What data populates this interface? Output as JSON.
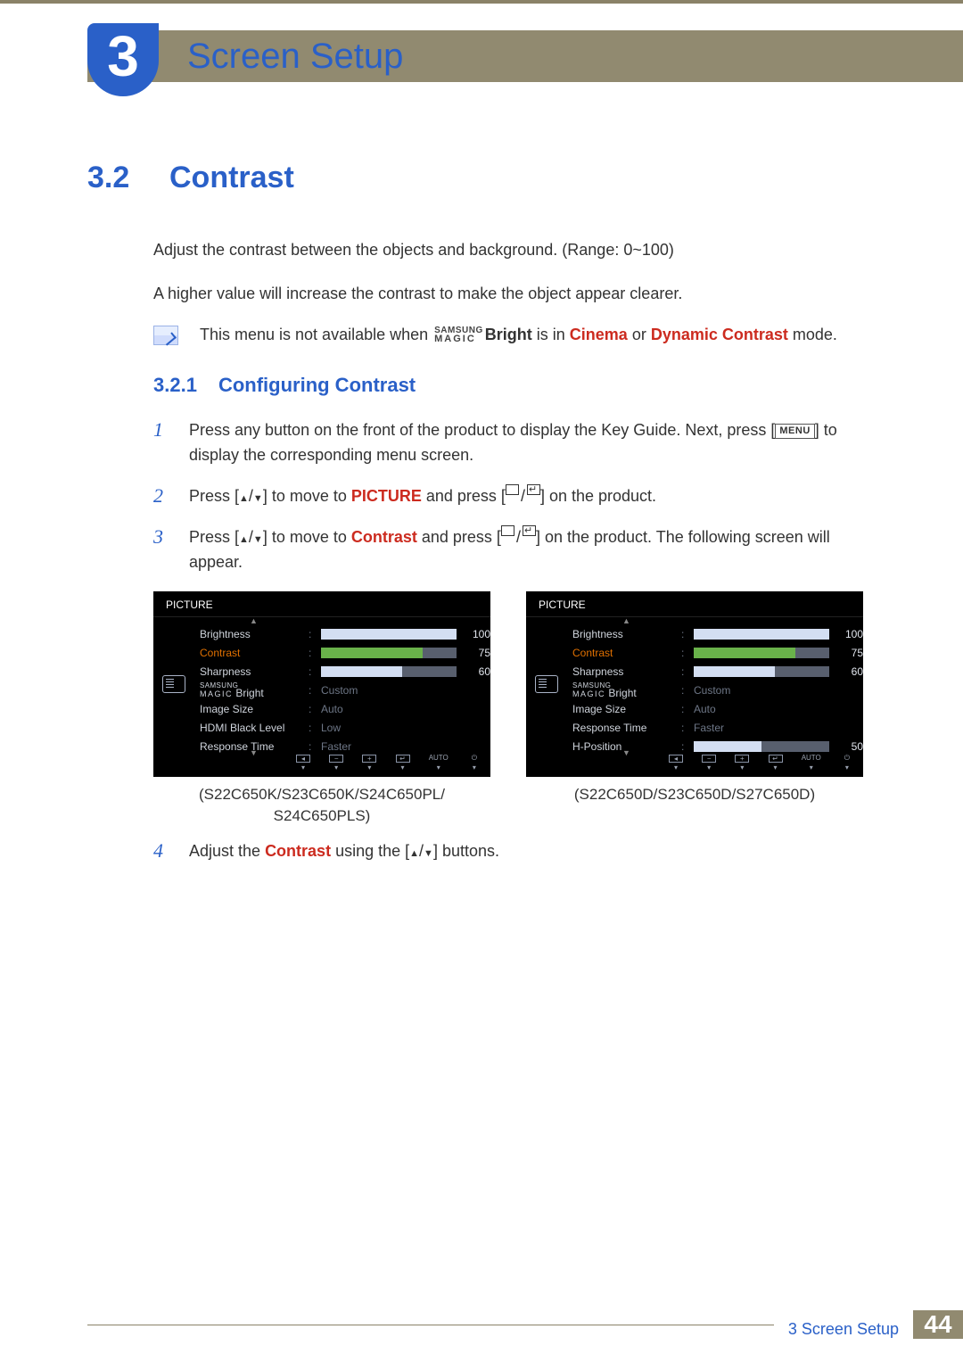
{
  "chapter": {
    "number": "3",
    "title": "Screen Setup"
  },
  "section": {
    "number": "3.2",
    "title": "Contrast"
  },
  "paras": {
    "intro1": "Adjust the contrast between the objects and background. (Range: 0~100)",
    "intro2": "A higher value will increase the contrast to make the object appear clearer."
  },
  "note": {
    "pre": "This menu is not available when ",
    "bright": "Bright",
    "mid": " is in ",
    "cinema": "Cinema",
    "or": " or ",
    "dyn": "Dynamic Contrast",
    "post": " mode."
  },
  "subsection": {
    "number": "3.2.1",
    "title": "Configuring Contrast"
  },
  "steps": {
    "s1a": "Press any button on the front of the product to display the Key Guide. Next, press [",
    "s1menu": "MENU",
    "s1b": "] to display the corresponding menu screen.",
    "s2a": "Press [",
    "s2b": "] to move to ",
    "s2c": "PICTURE",
    "s2d": " and press [",
    "s2e": "] on the product.",
    "s3a": "Press [",
    "s3b": "] to move to ",
    "s3c": "Contrast",
    "s3d": " and press [",
    "s3e": "] on the product. The following screen will appear.",
    "s4a": "Adjust the ",
    "s4b": "Contrast",
    "s4c": " using the [",
    "s4d": "] buttons."
  },
  "osd": {
    "title": "PICTURE",
    "labels": {
      "brightness": "Brightness",
      "contrast": "Contrast",
      "sharpness": "Sharpness",
      "magicBright": "Bright",
      "imageSize": "Image Size",
      "hdmiBlack": "HDMI Black Level",
      "response": "Response Time",
      "hpos": "H-Position"
    },
    "values": {
      "custom": "Custom",
      "auto": "Auto",
      "low": "Low",
      "faster": "Faster"
    },
    "numbers": {
      "brightness": "100",
      "contrast": "75",
      "sharpness": "60",
      "hpos": "50"
    },
    "foot": {
      "auto": "AUTO"
    }
  },
  "captions": {
    "left": "(S22C650K/S23C650K/S24C650PL/\nS24C650PLS)",
    "right": "(S22C650D/S23C650D/S27C650D)"
  },
  "footer": {
    "chapter": "3 Screen Setup",
    "page": "44"
  },
  "chart_data": [
    {
      "type": "table",
      "title": "PICTURE OSD (S22C650K/S23C650K/S24C650PL/S24C650PLS)",
      "rows": [
        {
          "label": "Brightness",
          "value": 100,
          "max": 100
        },
        {
          "label": "Contrast",
          "value": 75,
          "max": 100,
          "highlighted": true
        },
        {
          "label": "Sharpness",
          "value": 60,
          "max": 100
        },
        {
          "label": "SAMSUNG MAGIC Bright",
          "value": "Custom"
        },
        {
          "label": "Image Size",
          "value": "Auto"
        },
        {
          "label": "HDMI Black Level",
          "value": "Low"
        },
        {
          "label": "Response Time",
          "value": "Faster"
        }
      ]
    },
    {
      "type": "table",
      "title": "PICTURE OSD (S22C650D/S23C650D/S27C650D)",
      "rows": [
        {
          "label": "Brightness",
          "value": 100,
          "max": 100
        },
        {
          "label": "Contrast",
          "value": 75,
          "max": 100,
          "highlighted": true
        },
        {
          "label": "Sharpness",
          "value": 60,
          "max": 100
        },
        {
          "label": "SAMSUNG MAGIC Bright",
          "value": "Custom"
        },
        {
          "label": "Image Size",
          "value": "Auto"
        },
        {
          "label": "Response Time",
          "value": "Faster"
        },
        {
          "label": "H-Position",
          "value": 50,
          "max": 100
        }
      ]
    }
  ]
}
